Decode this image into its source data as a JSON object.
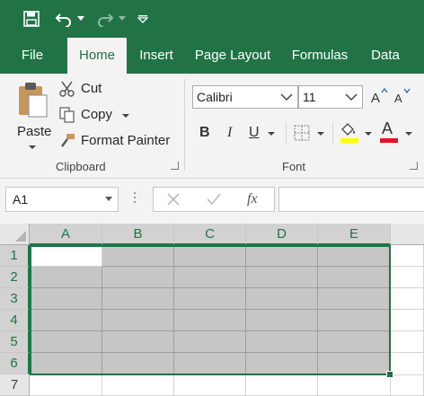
{
  "quick_access": {
    "icons": [
      "save-icon",
      "undo-icon",
      "redo-icon",
      "customize-icon"
    ]
  },
  "tabs": [
    "File",
    "Home",
    "Insert",
    "Page Layout",
    "Formulas",
    "Data"
  ],
  "active_tab": "Home",
  "clipboard": {
    "paste_label": "Paste",
    "cut_label": "Cut",
    "copy_label": "Copy",
    "format_painter_label": "Format Painter",
    "group_label": "Clipboard"
  },
  "font": {
    "font_name": "Calibri",
    "font_size": "11",
    "bold_label": "B",
    "italic_label": "I",
    "underline_label": "U",
    "font_color_label": "A",
    "group_label": "Font",
    "highlight_color": "#ffff00",
    "font_color": "#e81123"
  },
  "formula_bar": {
    "name_box": "A1",
    "fx_label": "fx",
    "formula": ""
  },
  "sheet": {
    "columns": [
      "A",
      "B",
      "C",
      "D",
      "E"
    ],
    "rows": [
      "1",
      "2",
      "3",
      "4",
      "5",
      "6",
      "7"
    ],
    "selection": "A1:E6",
    "active_cell": "A1"
  },
  "colors": {
    "accent": "#217346",
    "selection_fill": "#c6c6c6"
  }
}
